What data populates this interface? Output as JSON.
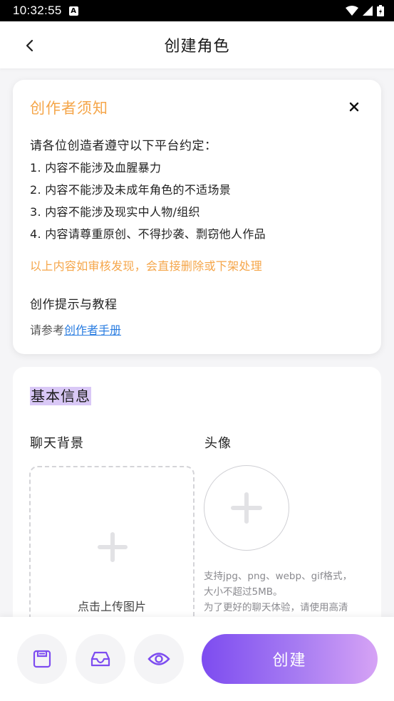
{
  "status_bar": {
    "time": "10:32:55",
    "badge": "A"
  },
  "header": {
    "title": "创建角色"
  },
  "notice": {
    "title": "创作者须知",
    "intro": "请各位创造者遵守以下平台约定：",
    "rules": [
      "1. 内容不能涉及血腥暴力",
      "2. 内容不能涉及未成年角色的不适场景",
      "3. 内容不能涉及现实中人物/组织",
      "4. 内容请尊重原创、不得抄袭、剽窃他人作品"
    ],
    "warning": "以上内容如审核发现，会直接删除或下架处理",
    "tips_title": "创作提示与教程",
    "tips_prefix": "请参考",
    "tips_link": "创作者手册"
  },
  "basic_info": {
    "title": "基本信息",
    "bg_label": "聊天背景",
    "avatar_label": "头像",
    "upload_text": "点击上传图片",
    "avatar_hint_1": "支持jpg、png、webp、gif格式，",
    "avatar_hint_2": "大小不超过5MB。",
    "avatar_hint_3": "为了更好的聊天体验，请使用高清"
  },
  "bottom_bar": {
    "create_label": "创建"
  },
  "colors": {
    "accent": "#7d4cf0",
    "warning": "#f5a64a",
    "link": "#2a7de1"
  }
}
